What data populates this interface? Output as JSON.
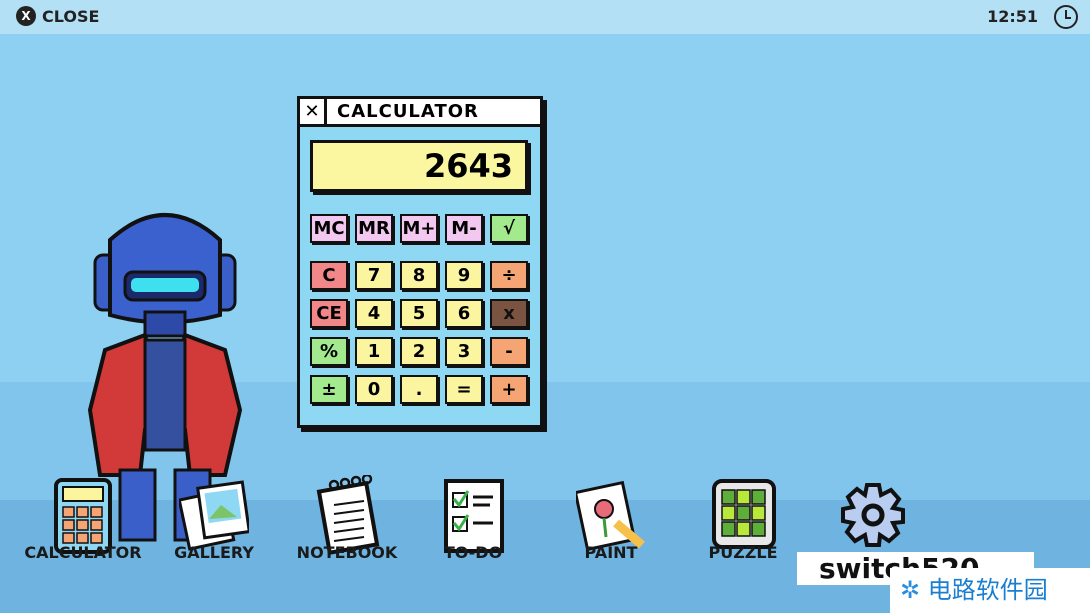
{
  "topbar": {
    "close_label": "CLOSE",
    "time": "12:51"
  },
  "calculator": {
    "title": "CALCULATOR",
    "display": "2643",
    "rows": [
      [
        {
          "l": "MC",
          "c": "#f3c8f0"
        },
        {
          "l": "MR",
          "c": "#f3c8f0"
        },
        {
          "l": "M+",
          "c": "#f3c8f0"
        },
        {
          "l": "M-",
          "c": "#f3c8f0"
        },
        {
          "l": "√",
          "c": "#a3ea8e"
        }
      ],
      [
        {
          "l": "C",
          "c": "#f2878a"
        },
        {
          "l": "7",
          "c": "#fbf5a0"
        },
        {
          "l": "8",
          "c": "#fbf5a0"
        },
        {
          "l": "9",
          "c": "#fbf5a0"
        },
        {
          "l": "÷",
          "c": "#f5a574"
        }
      ],
      [
        {
          "l": "CE",
          "c": "#f2878a"
        },
        {
          "l": "4",
          "c": "#fbf5a0"
        },
        {
          "l": "5",
          "c": "#fbf5a0"
        },
        {
          "l": "6",
          "c": "#fbf5a0"
        },
        {
          "l": "x",
          "c": "#7a5440"
        }
      ],
      [
        {
          "l": "%",
          "c": "#a3ea8e"
        },
        {
          "l": "1",
          "c": "#fbf5a0"
        },
        {
          "l": "2",
          "c": "#fbf5a0"
        },
        {
          "l": "3",
          "c": "#fbf5a0"
        },
        {
          "l": "-",
          "c": "#f5a574"
        }
      ],
      [
        {
          "l": "±",
          "c": "#a3ea8e"
        },
        {
          "l": "0",
          "c": "#fbf5a0"
        },
        {
          "l": ".",
          "c": "#fbf5a0"
        },
        {
          "l": "=",
          "c": "#fbf5a0"
        },
        {
          "l": "+",
          "c": "#f5a574"
        }
      ]
    ]
  },
  "dock": [
    {
      "label": "CALCULATOR",
      "icon": "calculator-icon"
    },
    {
      "label": "GALLERY",
      "icon": "gallery-icon"
    },
    {
      "label": "NOTEBOOK",
      "icon": "notebook-icon"
    },
    {
      "label": "TO-DO",
      "icon": "todo-icon"
    },
    {
      "label": "PAINT",
      "icon": "paint-icon"
    },
    {
      "label": "PUZZLE",
      "icon": "puzzle-icon"
    },
    {
      "label": "",
      "icon": "settings-gear-icon"
    }
  ],
  "watermark": {
    "line1": "switch520",
    "line2": "电路软件园"
  }
}
